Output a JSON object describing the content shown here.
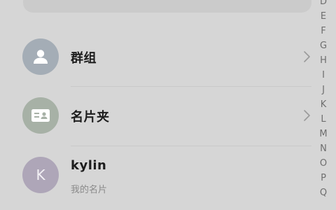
{
  "rows": [
    {
      "title": "群组",
      "icon": "group-icon"
    },
    {
      "title": "名片夹",
      "icon": "business-card-icon"
    },
    {
      "title": "kylin",
      "subtitle": "我的名片",
      "avatar_letter": "K"
    }
  ],
  "index_letters": [
    "D",
    "E",
    "F",
    "G",
    "H",
    "I",
    "J",
    "K",
    "L",
    "M",
    "N",
    "O",
    "P",
    "Q"
  ],
  "colors": {
    "background": "#d6d6d6",
    "avatar_group": "#a4adb6",
    "avatar_card": "#a7b1a6",
    "avatar_k": "#aea6b8"
  }
}
